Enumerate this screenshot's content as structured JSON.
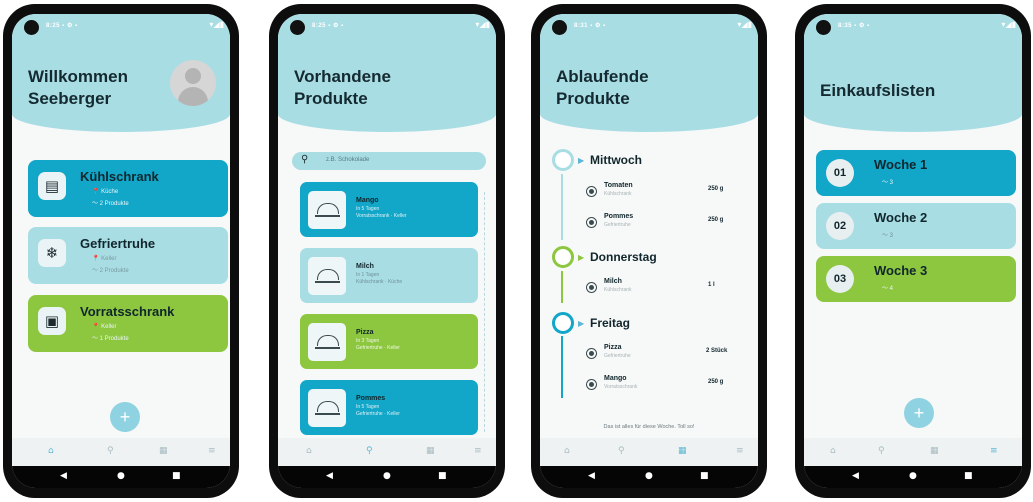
{
  "phones": [
    {
      "status": "8:25 ▪ ⚙ ▪",
      "title": "Willkommen Seeberger",
      "cards": [
        {
          "name": "Kühlschrank",
          "location": "Küche",
          "count": "2 Produkte",
          "icon": "fridge-icon"
        },
        {
          "name": "Gefriertruhe",
          "location": "Keller",
          "count": "2 Produkte",
          "icon": "snowflake-icon"
        },
        {
          "name": "Vorratsschrank",
          "location": "Keller",
          "count": "1 Produkte",
          "icon": "cabinet-icon"
        }
      ],
      "fab": "+"
    },
    {
      "status": "8:25 ▪ ⚙ ▪",
      "title": "Vorhandene Produkte",
      "search_placeholder": "z.B. Schokolade",
      "products": [
        {
          "name": "Mango",
          "expiry": "In 5 Tagen",
          "location": "Vorratsschrank · Keller"
        },
        {
          "name": "Milch",
          "expiry": "In 1 Tagen",
          "location": "Kühlschrank · Küche"
        },
        {
          "name": "Pizza",
          "expiry": "In 3 Tagen",
          "location": "Gefriertruhe · Keller"
        },
        {
          "name": "Pommes",
          "expiry": "In 5 Tagen",
          "location": "Gefriertruhe · Keller"
        }
      ]
    },
    {
      "status": "8:31 ▪ ⚙ ▪",
      "title": "Ablaufende Produkte",
      "days": [
        {
          "day": "Mittwoch",
          "items": [
            {
              "name": "Tomaten",
              "loc": "Kühlschrank",
              "qty": "250 g"
            },
            {
              "name": "Pommes",
              "loc": "Gefriertruhe",
              "qty": "250 g"
            }
          ]
        },
        {
          "day": "Donnerstag",
          "items": [
            {
              "name": "Milch",
              "loc": "Kühlschrank",
              "qty": "1 l"
            }
          ]
        },
        {
          "day": "Freitag",
          "items": [
            {
              "name": "Pizza",
              "loc": "Gefriertruhe",
              "qty": "2 Stück"
            },
            {
              "name": "Mango",
              "loc": "Vorratsschrank",
              "qty": "250 g"
            }
          ]
        }
      ],
      "footer": "Das ist alles für diese Woche. Toll so!"
    },
    {
      "status": "8:35 ▪ ⚙ ▪",
      "title": "Einkaufslisten",
      "lists": [
        {
          "num": "01",
          "name": "Woche 1",
          "count": "3"
        },
        {
          "num": "02",
          "name": "Woche 2",
          "count": "3"
        },
        {
          "num": "03",
          "name": "Woche 3",
          "count": "4"
        }
      ],
      "fab": "+"
    }
  ],
  "nav_icons": [
    "home-icon",
    "search-icon",
    "calendar-icon",
    "list-icon"
  ],
  "colors": {
    "accent_blue": "#12a6c8",
    "light_blue": "#a9dde4",
    "green": "#8dc63f"
  }
}
